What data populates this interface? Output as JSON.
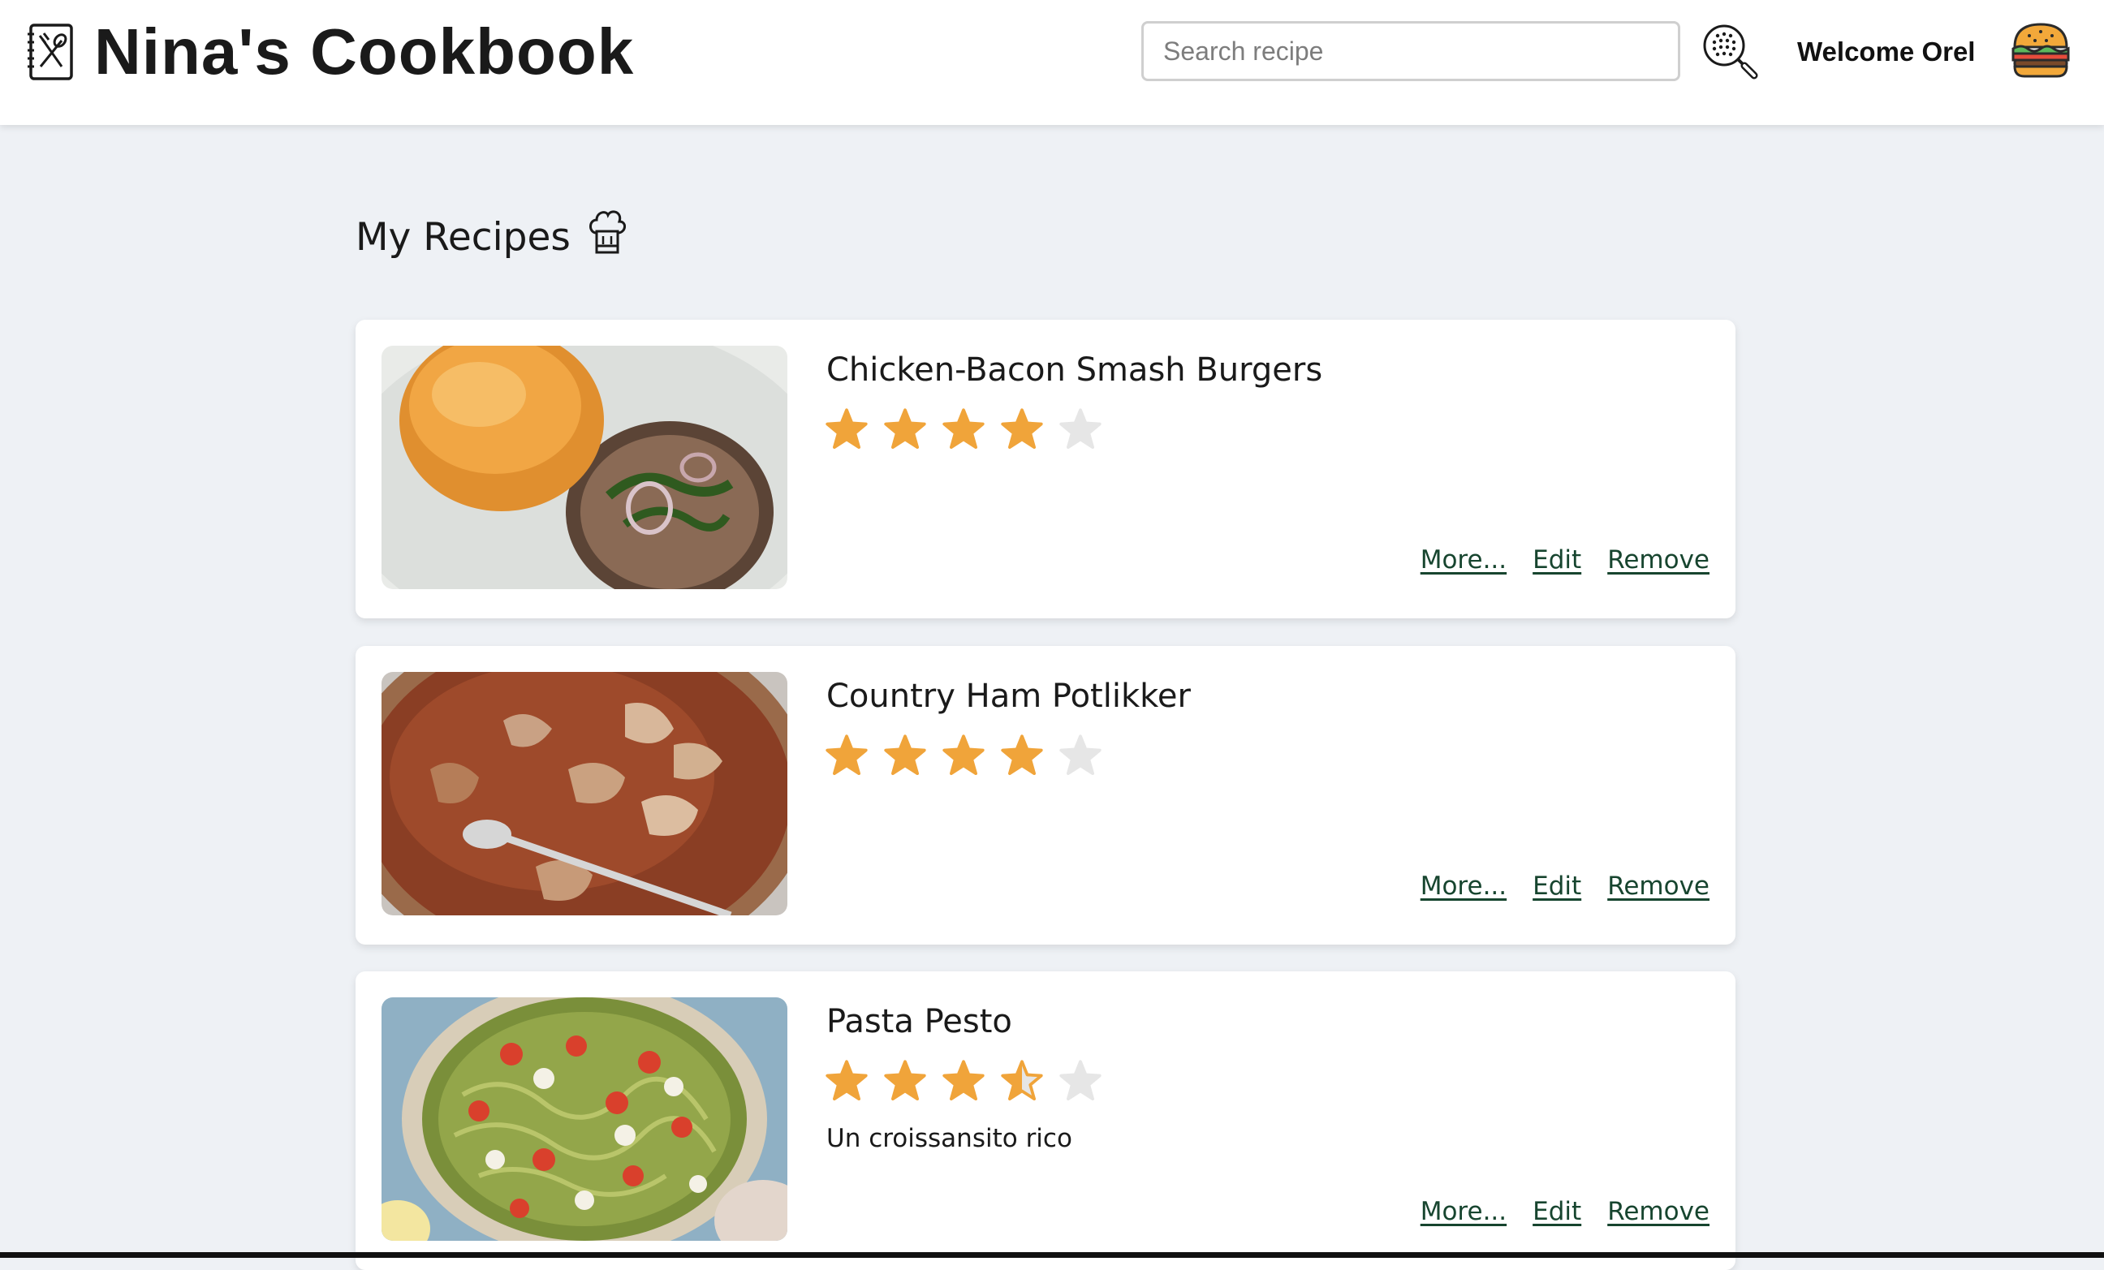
{
  "header": {
    "title": "Nina's Cookbook",
    "logo_icon": "cookbook-icon",
    "search_placeholder": "Search recipe",
    "search_value": "",
    "search_icon": "search-icon",
    "welcome": "Welcome Orel",
    "avatar_icon": "burger-icon"
  },
  "main": {
    "heading": "My Recipes",
    "heading_icon": "chef-hat-icon",
    "recipes": [
      {
        "title": "Chicken-Bacon Smash Burgers",
        "rating": 4,
        "description": "",
        "image": "burger-photo",
        "actions": {
          "more": "More...",
          "edit": "Edit",
          "remove": "Remove"
        }
      },
      {
        "title": "Country Ham Potlikker",
        "rating": 4,
        "description": "",
        "image": "potlikker-photo",
        "actions": {
          "more": "More...",
          "edit": "Edit",
          "remove": "Remove"
        }
      },
      {
        "title": "Pasta Pesto",
        "rating": 3.5,
        "description": "Un croissansito rico",
        "image": "pasta-pesto-photo",
        "actions": {
          "more": "More...",
          "edit": "Edit",
          "remove": "Remove"
        }
      }
    ],
    "rating_max": 5
  },
  "colors": {
    "background": "#eef1f5",
    "star_filled": "#f0a43a",
    "star_empty": "#e6e6e6",
    "link": "#17452f"
  }
}
